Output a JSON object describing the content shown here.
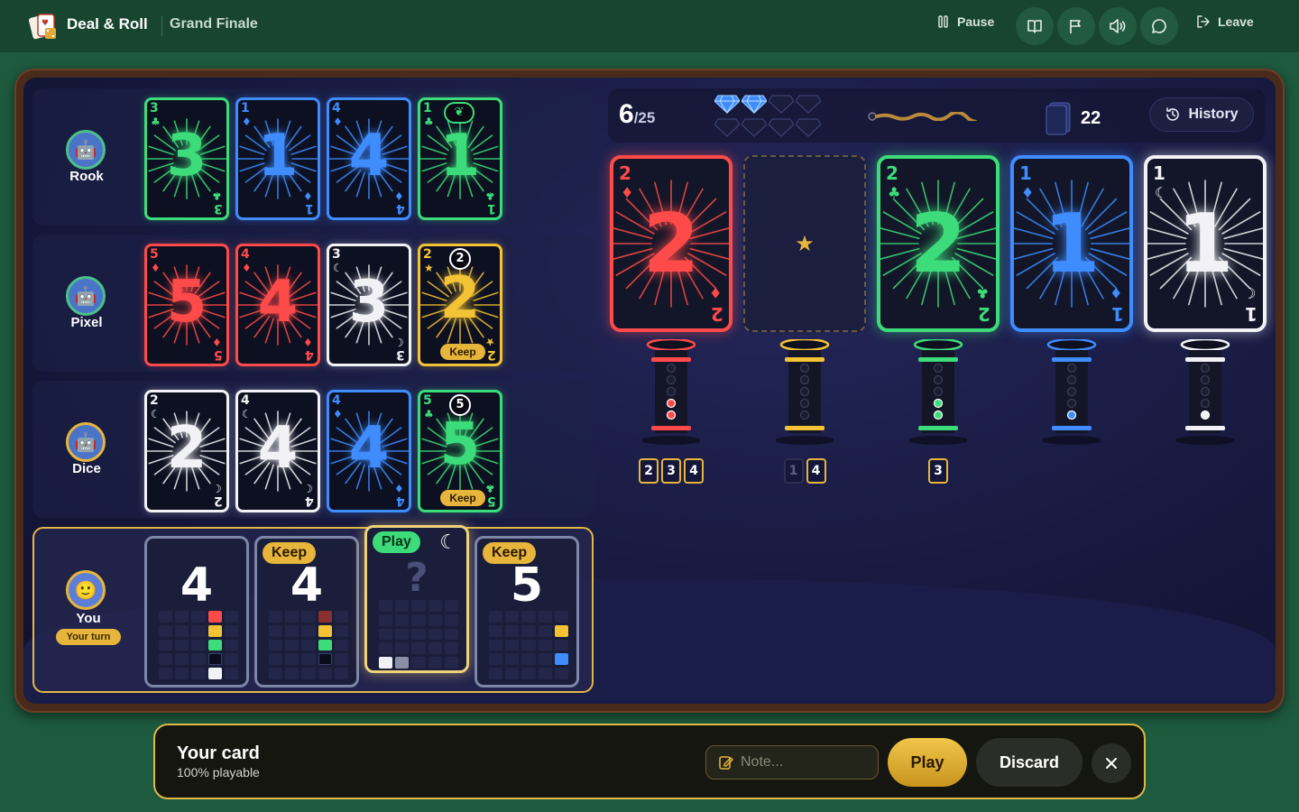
{
  "app": {
    "brand": "Deal & Roll",
    "subtitle": "Grand Finale"
  },
  "topbar": {
    "pause_label": "Pause",
    "leave_label": "Leave",
    "icons": [
      "rules-book-icon",
      "flag-icon",
      "sound-icon",
      "chat-icon"
    ]
  },
  "colors": {
    "red": "#ff4a4a",
    "green": "#3ddc7a",
    "blue": "#3f8cff",
    "white": "#f2f2f6",
    "yellow": "#f3c335",
    "accent": "#e7b53c"
  },
  "players": [
    {
      "name": "Rook",
      "cards": [
        {
          "rank": "3",
          "color": "green",
          "suit": "leaf"
        },
        {
          "rank": "1",
          "color": "blue",
          "suit": "drop"
        },
        {
          "rank": "4",
          "color": "blue",
          "suit": "drop"
        },
        {
          "rank": "1",
          "color": "green",
          "suit": "leaf",
          "hint_icon": "leaf"
        }
      ]
    },
    {
      "name": "Pixel",
      "cards": [
        {
          "rank": "5",
          "color": "red",
          "suit": "flame"
        },
        {
          "rank": "4",
          "color": "red",
          "suit": "flame"
        },
        {
          "rank": "3",
          "color": "white",
          "suit": "moon"
        },
        {
          "rank": "2",
          "color": "yellow",
          "suit": "star",
          "hint": "2",
          "keep": "Keep"
        }
      ]
    },
    {
      "name": "Dice",
      "cards": [
        {
          "rank": "2",
          "color": "white",
          "suit": "moon"
        },
        {
          "rank": "4",
          "color": "white",
          "suit": "moon"
        },
        {
          "rank": "4",
          "color": "blue",
          "suit": "drop"
        },
        {
          "rank": "5",
          "color": "green",
          "suit": "leaf",
          "hint": "5",
          "keep": "Keep"
        }
      ]
    }
  ],
  "me": {
    "name": "You",
    "turn_label": "Your turn",
    "cards": [
      {
        "rank": "4",
        "tag": "",
        "chips": [
          "red",
          "yellow",
          "green",
          "dark",
          "white"
        ]
      },
      {
        "rank": "4",
        "tag": "Keep",
        "chips": [
          "dim-red",
          "yellow",
          "green",
          "dark"
        ]
      },
      {
        "rank": "?",
        "tag": "Play",
        "hint_icon": "moon",
        "chips": [
          "white",
          "grey"
        ]
      },
      {
        "rank": "5",
        "tag": "Keep",
        "chips": [
          "yellow",
          "blue"
        ]
      }
    ]
  },
  "status": {
    "score": "6",
    "score_total": "/25",
    "hint_tokens": {
      "filled": 2,
      "total": 8
    },
    "fuse_level": 0.9,
    "deck_count": "22",
    "history_label": "History"
  },
  "fireworks": [
    {
      "color": "red",
      "rank": "2",
      "suit": "flame",
      "level": 2
    },
    {
      "color": "yellow",
      "rank": "",
      "suit": "star",
      "level": 0,
      "empty": true
    },
    {
      "color": "green",
      "rank": "2",
      "suit": "leaf",
      "level": 2
    },
    {
      "color": "blue",
      "rank": "1",
      "suit": "drop",
      "level": 1
    },
    {
      "color": "white",
      "rank": "1",
      "suit": "moon",
      "level": 1
    }
  ],
  "discards": [
    {
      "values": [
        "2",
        "3",
        "4"
      ],
      "dim": []
    },
    {
      "values": [
        "1",
        "4"
      ],
      "dim": [
        0
      ]
    },
    {
      "values": [
        "3"
      ],
      "dim": []
    },
    {
      "values": [],
      "dim": []
    },
    {
      "values": [],
      "dim": []
    }
  ],
  "action": {
    "title": "Your card",
    "subtitle": "100% playable",
    "note_placeholder": "Note...",
    "play_label": "Play",
    "discard_label": "Discard"
  }
}
